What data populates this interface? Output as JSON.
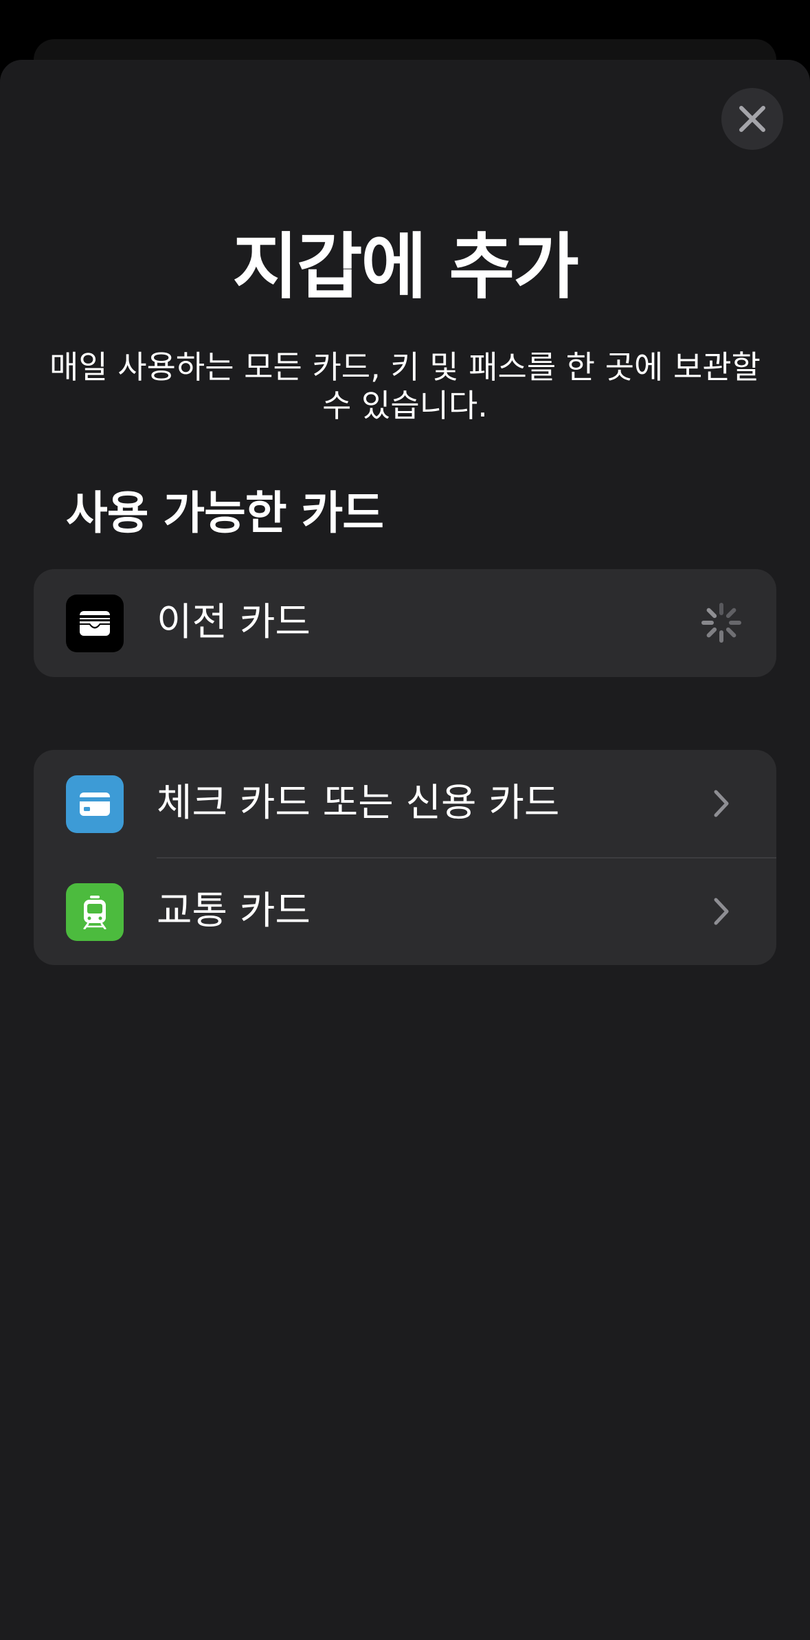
{
  "sheet": {
    "title": "지갑에 추가",
    "subtitle": "매일 사용하는 모든 카드, 키 및 패스를 한 곳에 보관할 수 있습니다.",
    "close_icon": "close-icon"
  },
  "available_section": {
    "header": "사용 가능한 카드",
    "items": [
      {
        "label": "이전 카드",
        "icon": "wallet-icon",
        "trailing": "loading-spinner-icon",
        "icon_bg": "#000000"
      }
    ]
  },
  "add_section": {
    "items": [
      {
        "label": "체크 카드 또는 신용 카드",
        "icon": "credit-card-icon",
        "trailing": "chevron-right-icon",
        "icon_bg": "#3d9bd6"
      },
      {
        "label": "교통 카드",
        "icon": "train-icon",
        "trailing": "chevron-right-icon",
        "icon_bg": "#4cbb3e"
      }
    ]
  },
  "colors": {
    "sheet_bg": "#1c1c1e",
    "cell_bg": "#2c2c2e",
    "separator": "#3d3d40",
    "chevron": "#8e8e93"
  }
}
